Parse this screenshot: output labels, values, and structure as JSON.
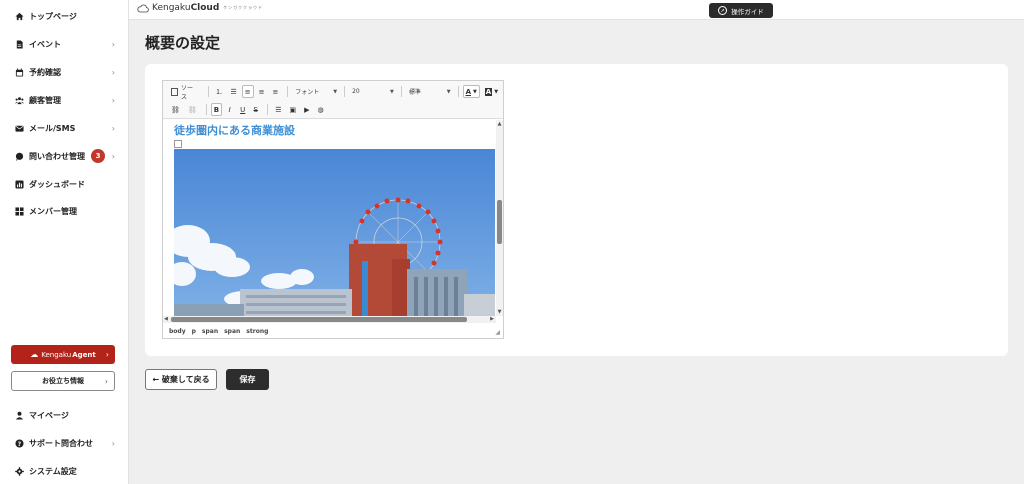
{
  "sidebar": {
    "items": [
      {
        "label": "トップページ",
        "icon": "home-icon",
        "chevron": false
      },
      {
        "label": "イベント",
        "icon": "document-icon",
        "chevron": true
      },
      {
        "label": "予約確認",
        "icon": "calendar-icon",
        "chevron": true
      },
      {
        "label": "顧客管理",
        "icon": "users-icon",
        "chevron": true
      },
      {
        "label": "メール/SMS",
        "icon": "mail-icon",
        "chevron": true
      },
      {
        "label": "問い合わせ管理",
        "icon": "chat-icon",
        "chevron": true,
        "badge": "3"
      },
      {
        "label": "ダッシュボード",
        "icon": "chart-icon",
        "chevron": false
      },
      {
        "label": "メンバー管理",
        "icon": "grid-icon",
        "chevron": false
      }
    ],
    "agent_button": {
      "prefix": "Kengaku",
      "label": "Agent"
    },
    "info_button": "お役立ち情報",
    "bottom_items": [
      {
        "label": "マイページ",
        "icon": "person-icon",
        "chevron": false
      },
      {
        "label": "サポート問合わせ",
        "icon": "help-icon",
        "chevron": true
      },
      {
        "label": "システム設定",
        "icon": "gear-icon",
        "chevron": false
      }
    ],
    "chevron": "›"
  },
  "header": {
    "logo_prefix": "Kengaku",
    "logo_bold": "Cloud",
    "logo_tagline": "ケンガククラウド",
    "guide_button": "操作ガイド"
  },
  "page": {
    "title": "概要の設定"
  },
  "editor": {
    "toolbar": {
      "source": "ソース",
      "font": "フォント",
      "size": "20",
      "format": "標準",
      "color_letter": "A",
      "bg_letter": "A",
      "bold": "B",
      "italic": "I",
      "underline": "U",
      "strike": "S"
    },
    "content_heading": "徒歩圏内にある商業施設",
    "statusbar": [
      "body",
      "p",
      "span",
      "span",
      "strong"
    ],
    "accent_color": "#3e8fd6"
  },
  "actions": {
    "back": "← 破棄して戻る",
    "save": "保存"
  }
}
